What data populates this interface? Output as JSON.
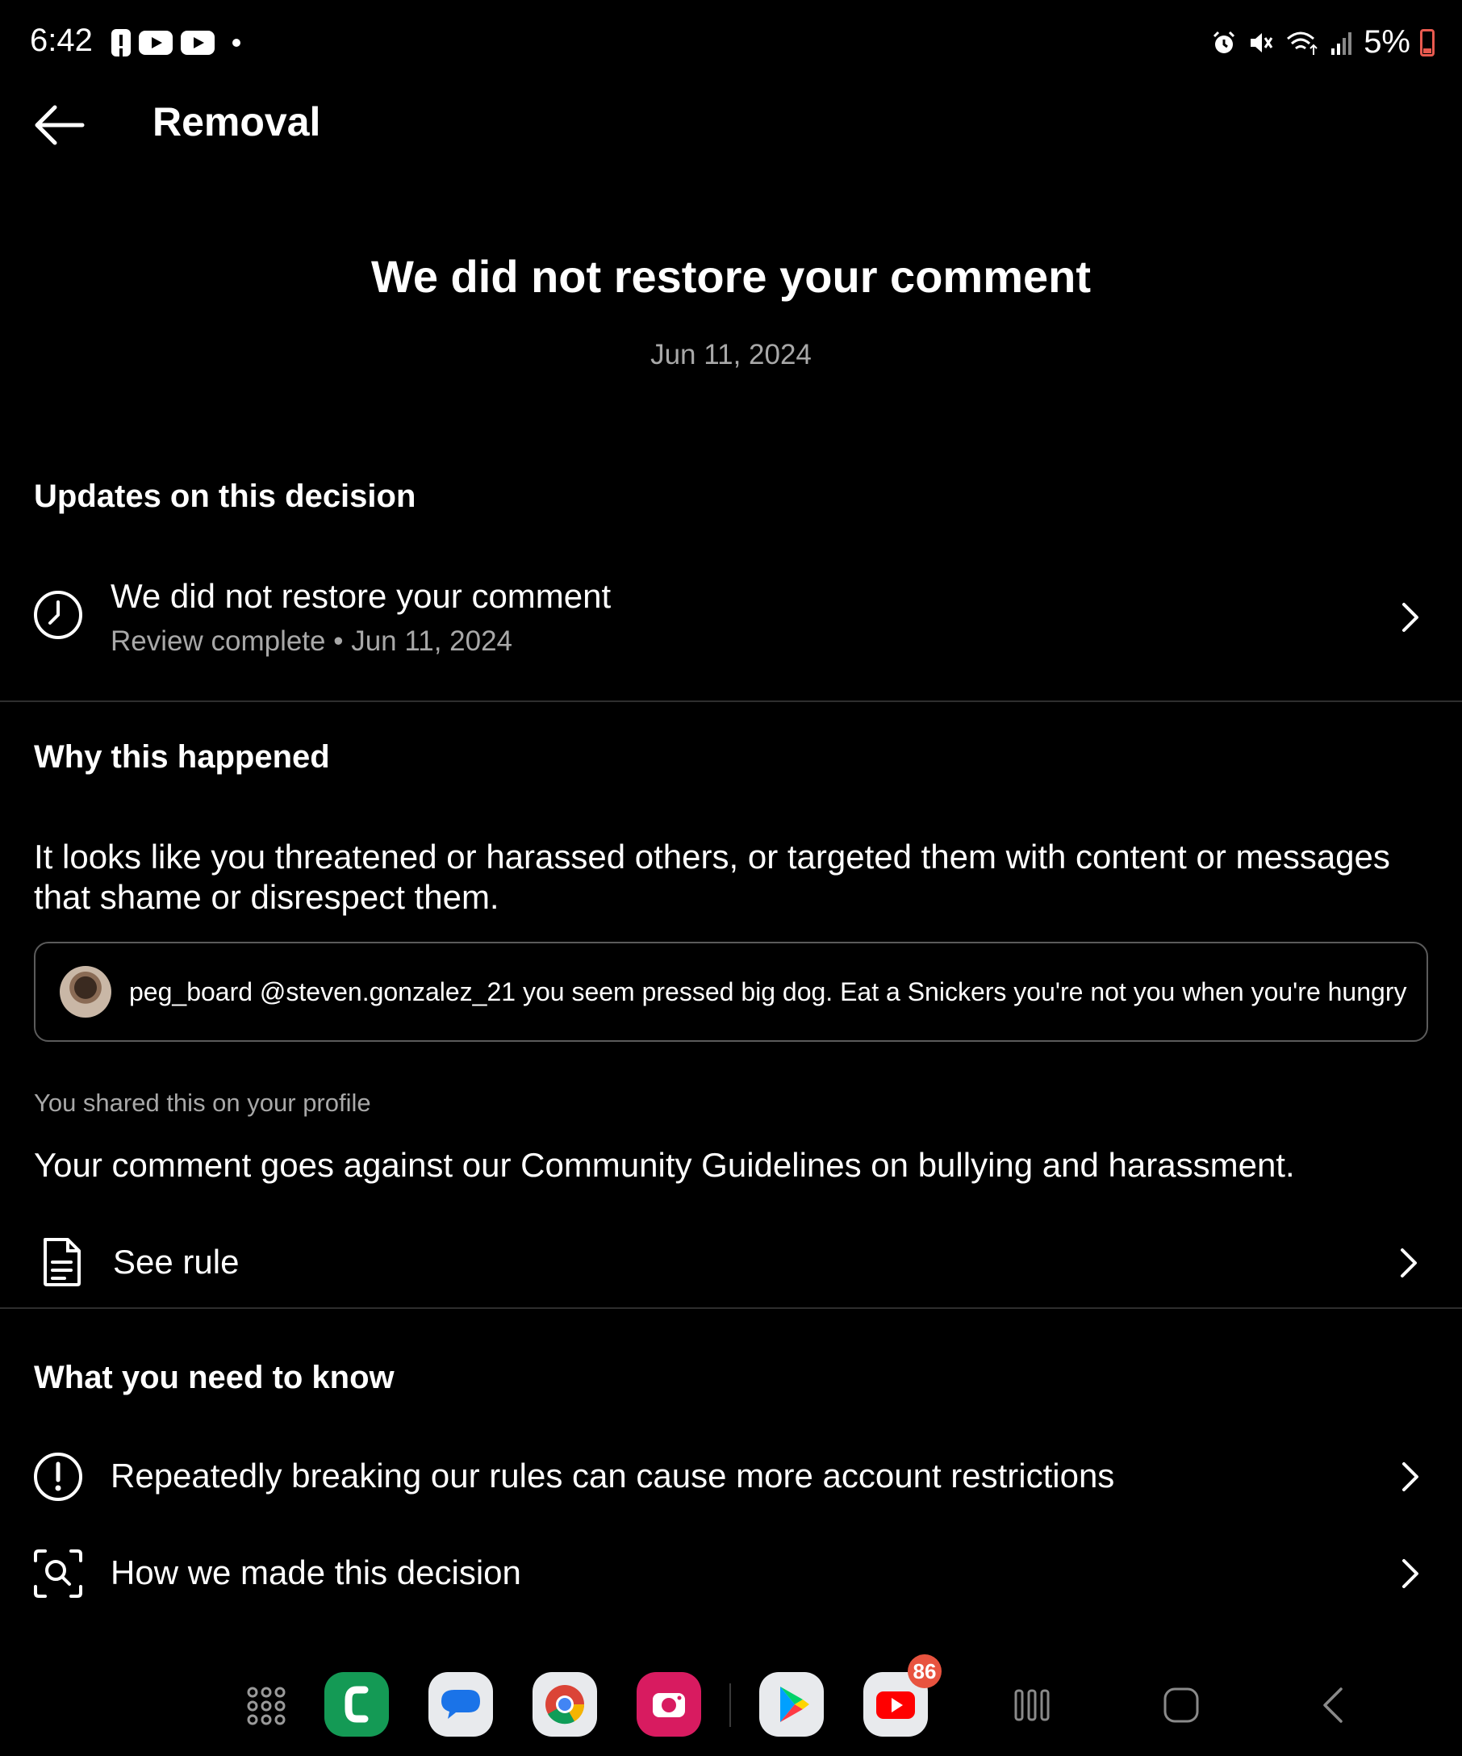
{
  "status_bar": {
    "time": "6:42",
    "battery": "5%"
  },
  "header": {
    "title": "Removal"
  },
  "hero": {
    "title": "We did not restore your comment",
    "date": "Jun 11, 2024"
  },
  "updates": {
    "heading": "Updates on this decision",
    "item_title": "We did not restore your comment",
    "item_subtitle": "Review complete • Jun 11, 2024"
  },
  "why": {
    "heading": "Why this happened",
    "explanation": "It looks like you threatened or harassed others, or targeted them with content or messages that shame or disrespect them.",
    "comment": "peg_board @steven.gonzalez_21 you seem pressed big dog. Eat a Snickers you're not you when you're hungry",
    "shared_note": "You shared this on your profile",
    "guideline": "Your comment goes against our Community Guidelines on bullying and harassment.",
    "see_rule_label": "See rule"
  },
  "know": {
    "heading": "What you need to know",
    "items": [
      {
        "label": "Repeatedly breaking our rules can cause more account restrictions"
      },
      {
        "label": "How we made this decision"
      }
    ]
  },
  "dock": {
    "apps": [
      "apps-grid-icon",
      "phone-icon",
      "messages-icon",
      "chrome-icon",
      "camera-icon",
      "play-store-icon",
      "youtube-icon"
    ],
    "youtube_badge": "86"
  }
}
